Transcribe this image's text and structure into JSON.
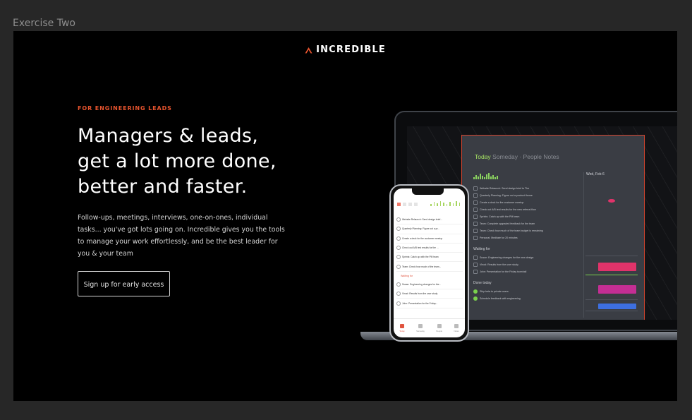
{
  "frame": {
    "label": "Exercise Two"
  },
  "brand": {
    "name": "INCREDIBLE",
    "logo_icon": "chevron-up-logo-icon",
    "accent": "#e8542e"
  },
  "hero": {
    "eyebrow": "FOR ENGINEERING LEADS",
    "headline": [
      "Managers & leads,",
      "get a lot more done,",
      "better and faster."
    ],
    "body": "Follow-ups, meetings, interviews, one-on-ones, individual tasks... you've got lots going on. Incredible gives you the tools to manage your work effortlessly, and be the best leader for you & your team",
    "cta_label": "Sign up for early access"
  },
  "desktop_app": {
    "tabs": [
      "Today",
      "Someday",
      "People",
      "Notes"
    ],
    "date": "Wed, Feb 6",
    "tasks": [
      "Website Relaunch: Send design brief to The",
      "Quarterly Planning: Figure out a product theme",
      "Create a deck for the customer meetup",
      "Check out A/B test results for the new referral flow",
      "Sprints: Catch up with the PM team",
      "Team: Complete upgraded feedback for the team",
      "Team: Check how much of the team budget is remaining",
      "Personal: Meditate for 20 minutes"
    ],
    "waiting_for_label": "Waiting for",
    "waiting": [
      "Susan: Engineering changes for the new design",
      "Vinod: Results from the user study",
      "John: Presentation for the Friday townhall"
    ],
    "done_label": "Done today",
    "done": [
      "Ship beta to private users",
      "Schedule feedback with engineering"
    ]
  },
  "phone_app": {
    "tasks": [
      "Website Relaunch: Send design brief...",
      "Quarterly Planning: Figure out a pr...",
      "Create a deck for the customer meetup",
      "Check out A/B test results for the ...",
      "Sprints: Catch up with the PM team",
      "Team: Check how much of the team..."
    ],
    "waiting_label": "Waiting for",
    "waiting": [
      "Susan: Engineering changes for the...",
      "Vinod: Results from the user study",
      "John: Presentation for the Friday..."
    ],
    "tabbar": [
      "Today",
      "Someday",
      "People",
      "Notes"
    ]
  }
}
